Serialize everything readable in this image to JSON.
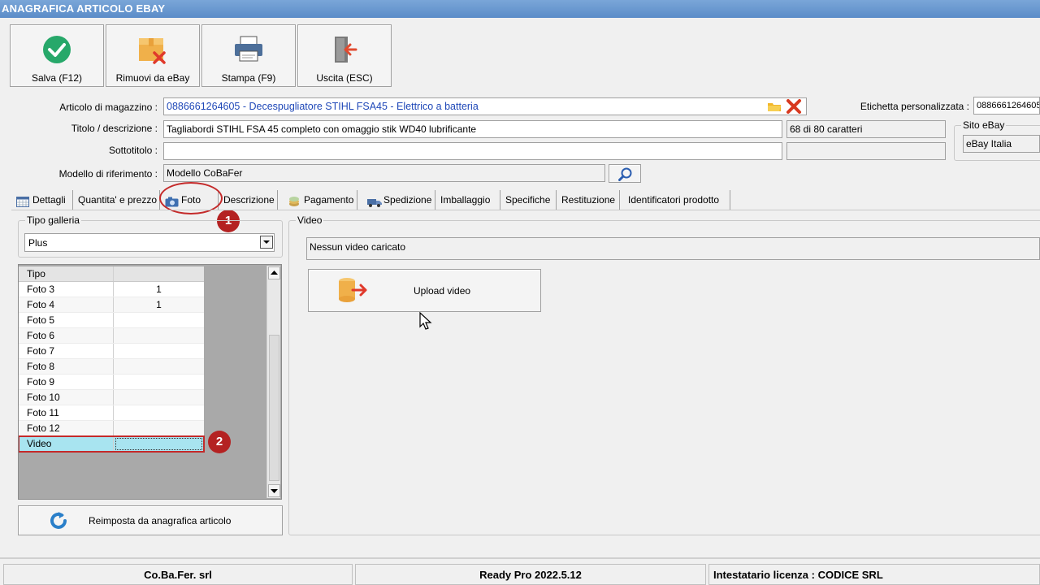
{
  "window": {
    "title": "ANAGRAFICA ARTICOLO EBAY"
  },
  "toolbar": {
    "save_label": "Salva (F12)",
    "remove_label": "Rimuovi da eBay",
    "print_label": "Stampa (F9)",
    "exit_label": "Uscita (ESC)"
  },
  "form": {
    "articolo_label": "Articolo di magazzino :",
    "articolo_value": "0886661264605 - Decespugliatore STIHL FSA45 - Elettrico a batteria",
    "titolo_label": "Titolo / descrizione :",
    "titolo_value": "Tagliabordi STIHL FSA 45 completo con omaggio stik WD40 lubrificante",
    "char_count": "68 di 80 caratteri",
    "sottotitolo_label": "Sottotitolo :",
    "sottotitolo_value": "",
    "modello_label": "Modello di riferimento :",
    "modello_value": "Modello CoBaFer",
    "etichetta_label": "Etichetta personalizzata :",
    "etichetta_value": "0886661264605",
    "sito_label": "Sito eBay",
    "sito_value": "eBay Italia"
  },
  "tabs": [
    {
      "label": "Dettagli",
      "icon": "calendar-icon"
    },
    {
      "label": "Quantita' e prezzo",
      "icon": ""
    },
    {
      "label": "Foto",
      "icon": "camera-icon"
    },
    {
      "label": "Descrizione",
      "icon": ""
    },
    {
      "label": "Pagamento",
      "icon": "coins-icon"
    },
    {
      "label": "Spedizione",
      "icon": "truck-icon"
    },
    {
      "label": "Imballaggio",
      "icon": ""
    },
    {
      "label": "Specifiche",
      "icon": ""
    },
    {
      "label": "Restituzione",
      "icon": ""
    },
    {
      "label": "Identificatori prodotto",
      "icon": ""
    }
  ],
  "gallery": {
    "label": "Tipo galleria",
    "value": "Plus"
  },
  "photo_grid": {
    "header": "Tipo",
    "rows": [
      {
        "tipo": "Foto 3",
        "value": "1"
      },
      {
        "tipo": "Foto 4",
        "value": "1"
      },
      {
        "tipo": "Foto 5",
        "value": ""
      },
      {
        "tipo": "Foto 6",
        "value": ""
      },
      {
        "tipo": "Foto 7",
        "value": ""
      },
      {
        "tipo": "Foto 8",
        "value": ""
      },
      {
        "tipo": "Foto 9",
        "value": ""
      },
      {
        "tipo": "Foto 10",
        "value": ""
      },
      {
        "tipo": "Foto 11",
        "value": ""
      },
      {
        "tipo": "Foto 12",
        "value": ""
      },
      {
        "tipo": "Video",
        "value": ""
      }
    ]
  },
  "reset_label": "Reimposta da anagrafica articolo",
  "video": {
    "label": "Video",
    "status": "Nessun video caricato",
    "upload_label": "Upload video"
  },
  "markers": {
    "one": "1",
    "two": "2"
  },
  "statusbar": {
    "company": "Co.Ba.Fer. srl",
    "version": "Ready Pro 2022.5.12",
    "license": "Intestatario licenza : CODICE SRL"
  },
  "colors": {
    "accent": "#1f48b8",
    "marker": "#b42222",
    "selection": "#a8e4f0"
  }
}
